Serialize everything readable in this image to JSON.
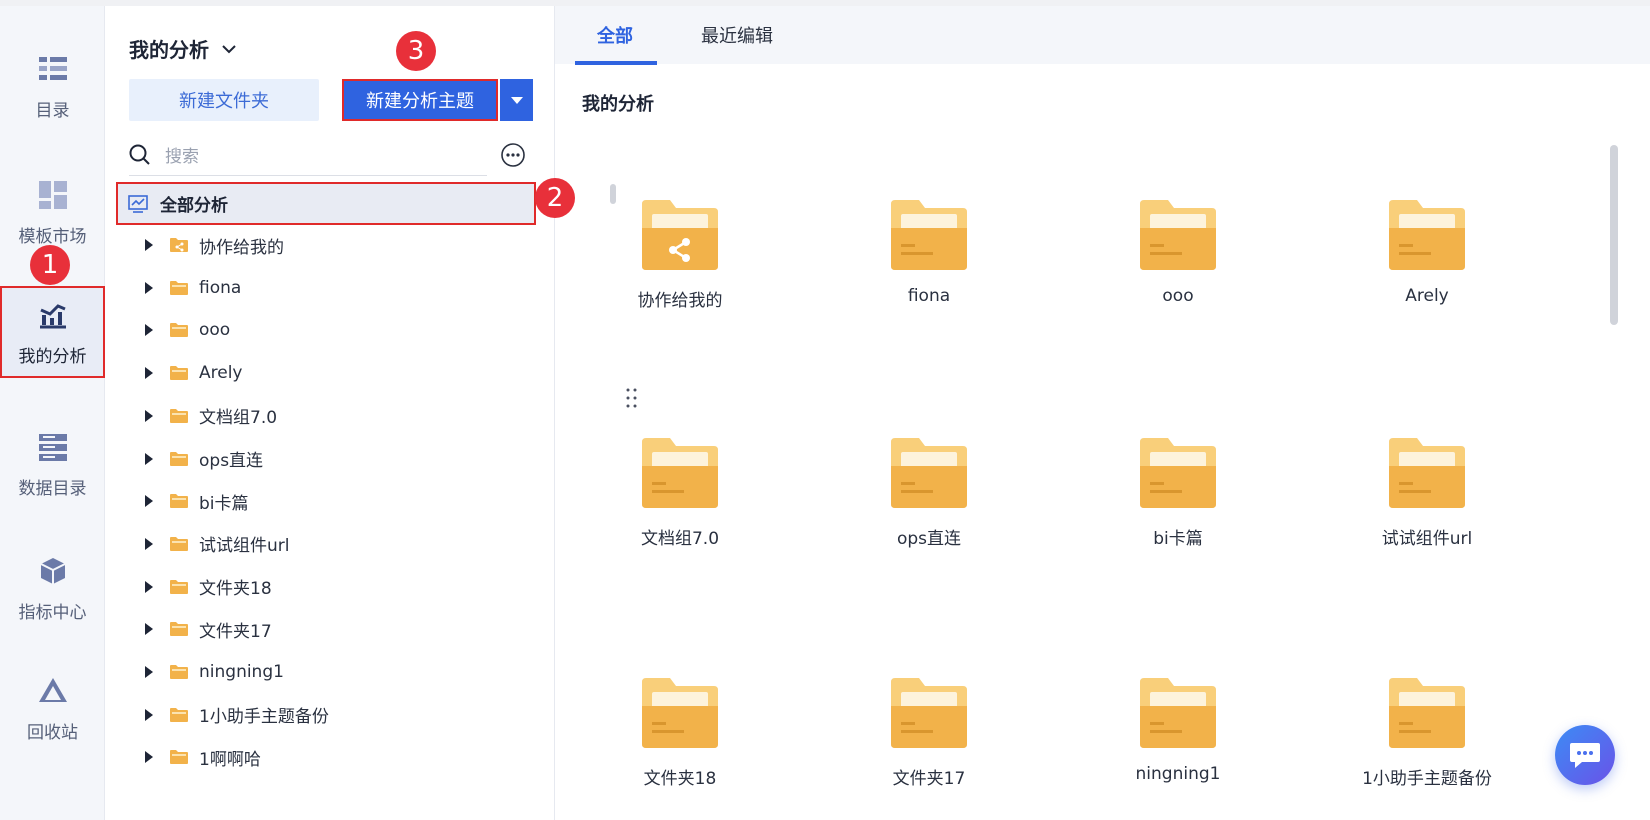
{
  "rail": {
    "items": [
      {
        "label": "目录",
        "icon": "list-icon"
      },
      {
        "label": "模板市场",
        "icon": "template-grid-icon"
      },
      {
        "label": "我的分析",
        "icon": "analysis-chart-icon",
        "active": true
      },
      {
        "label": "数据目录",
        "icon": "data-catalog-icon"
      },
      {
        "label": "指标中心",
        "icon": "metric-cube-icon"
      },
      {
        "label": "回收站",
        "icon": "recycle-icon"
      }
    ]
  },
  "panel": {
    "title": "我的分析",
    "new_folder_label": "新建文件夹",
    "new_topic_label": "新建分析主题",
    "search_placeholder": "搜索",
    "root_label": "全部分析",
    "tree": [
      "协作给我的",
      "fiona",
      "ooo",
      "Arely",
      "文档组7.0",
      "ops直连",
      "bi卡篇",
      "试试组件url",
      "文件夹18",
      "文件夹17",
      "ningning1",
      "1小助手主题备份",
      "1啊啊哈"
    ]
  },
  "main": {
    "tabs": [
      "全部",
      "最近编辑"
    ],
    "section_title": "我的分析",
    "folders": [
      "协作给我的",
      "fiona",
      "ooo",
      "Arely",
      "文档组7.0",
      "ops直连",
      "bi卡篇",
      "试试组件url",
      "文件夹18",
      "文件夹17",
      "ningning1",
      "1小助手主题备份"
    ]
  },
  "badges": [
    "1",
    "2",
    "3"
  ],
  "colors": {
    "accent": "#2f63e0",
    "badge": "#e8303a",
    "folder": "#f2b24a",
    "highlight": "#e02a2a"
  }
}
